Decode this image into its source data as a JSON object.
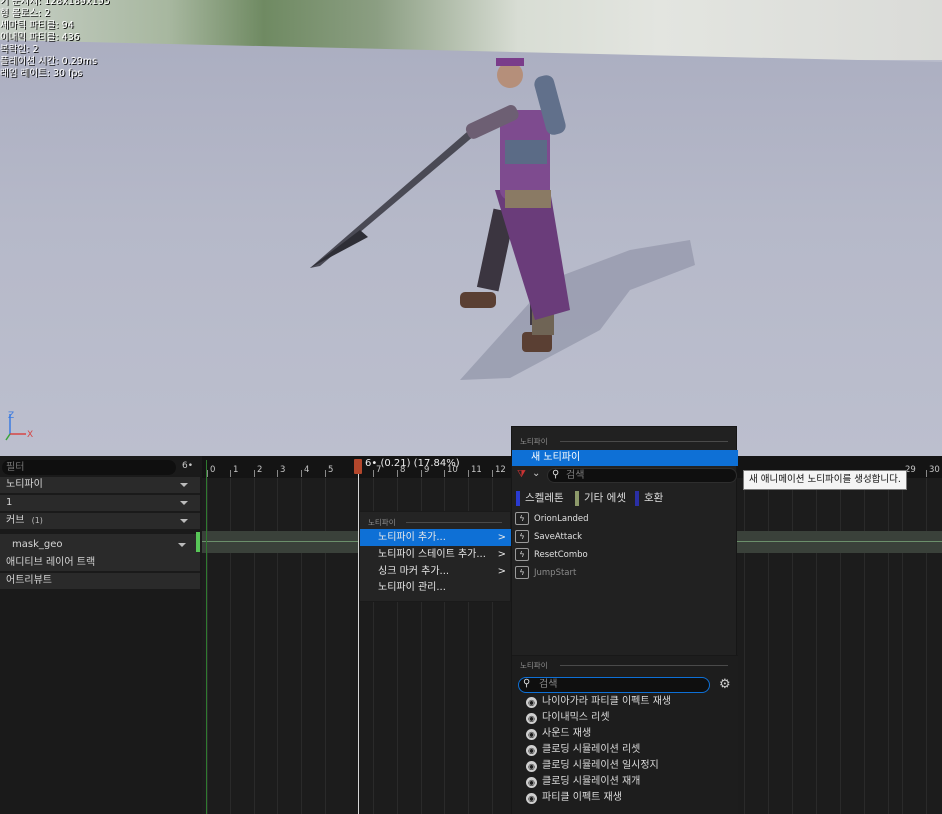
{
  "viewport": {
    "stats": [
      "기 눈지지: 128x189x195",
      "형 롤로스: 2",
      "세마틱 파티클: 94",
      "이내믹 파티클: 436",
      "복락인: 2",
      "플레이션 시간: 0.29ms",
      "레임 레이트: 30 fps"
    ],
    "axis_z": "Z",
    "axis_x": "X"
  },
  "left_panel": {
    "filter_placeholder": "필터",
    "filter_count": "6•",
    "tracks": {
      "notify": "노티파이",
      "notify_track": "1",
      "curves": "커브",
      "curves_count": "(1)",
      "curve_item": "mask_geo",
      "additive": "애디티브 레이어 트랙",
      "attributes": "어트리뷰트"
    },
    "curve_color": "#58c658"
  },
  "timeline": {
    "playhead_label": "6• (0.21) (17.84%)",
    "ticks": [
      "0",
      "1",
      "2",
      "3",
      "4",
      "5",
      "7",
      "8",
      "9",
      "10",
      "11",
      "12",
      "29",
      "30"
    ]
  },
  "context_menu": {
    "header": "노티파이",
    "items": [
      {
        "label": "노티파이 추가...",
        "arrow": ">"
      },
      {
        "label": "노티파이 스테이트 추가...",
        "arrow": ">"
      },
      {
        "label": "싱크 마커 추가...",
        "arrow": ">"
      },
      {
        "label": "노티파이 관리..."
      }
    ]
  },
  "notify_menu": {
    "header": "노티파이",
    "new_notify": "새 노티파이",
    "search_placeholder": "검색",
    "tags": [
      {
        "label": "스켈레톤",
        "color": "#2a3bd1"
      },
      {
        "label": "기타 에셋",
        "color": "#8d9a6a"
      },
      {
        "label": "호환",
        "color": "#2a2fa6"
      }
    ],
    "items": [
      "OrionLanded",
      "SaveAttack",
      "ResetCombo",
      "JumpStart"
    ],
    "lower_header": "노티파이",
    "lower_search_placeholder": "검색",
    "effects": [
      "나이아가라 파티클 이펙트 재생",
      "다이내믹스 리셋",
      "사운드 재생",
      "클로딩 시뮬레이션 리셋",
      "클로딩 시뮬레이션 일시정지",
      "클로딩 시뮬레이션 재개",
      "파티클 이펙트 재생"
    ]
  },
  "tooltip": "새 애니메이션 노티파이를 생성합니다.",
  "colors": {
    "accent": "#0e70d6",
    "playhead": "#b3472c"
  }
}
